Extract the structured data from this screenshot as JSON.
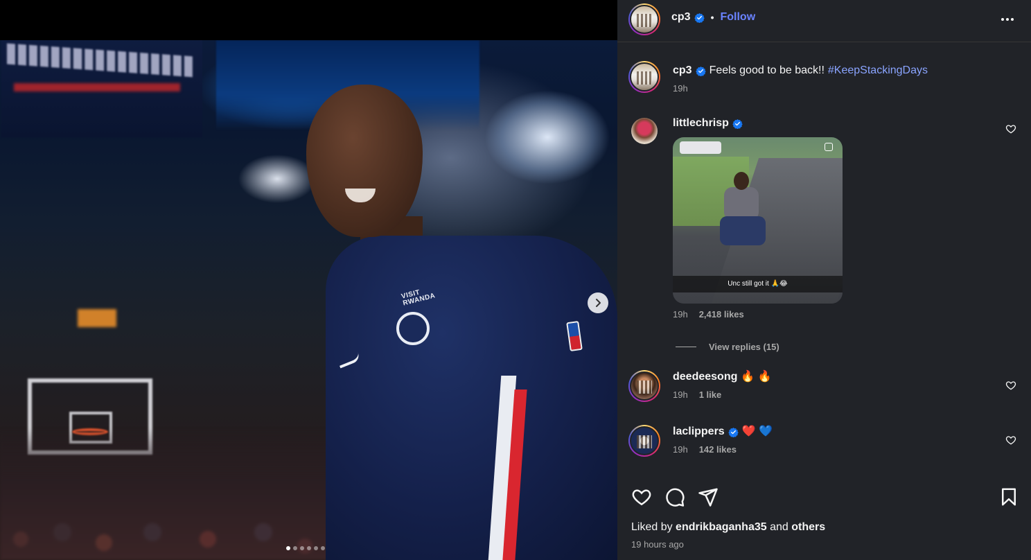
{
  "post": {
    "username": "cp3",
    "follow_label": "Follow",
    "separator": "•",
    "caption_text": "Feels good to be back!!",
    "caption_hashtag": "#KeepStackingDays",
    "caption_time": "19h",
    "liked_by_prefix": "Liked by",
    "liked_by_user": "endrikbaganha35",
    "liked_by_and": "and",
    "liked_by_others": "others",
    "time_ago": "19 hours ago"
  },
  "carousel": {
    "dots": 6,
    "active_index": 0
  },
  "comments": [
    {
      "username": "littlechrisp",
      "verified": true,
      "text": "",
      "time": "19h",
      "likes": "2,418 likes",
      "gif_caption": "Unc still got it 🙏😂",
      "view_replies": "View replies (15)"
    },
    {
      "username": "deedeesong",
      "verified": false,
      "text": "🔥 🔥",
      "time": "19h",
      "likes": "1 like"
    },
    {
      "username": "laclippers",
      "verified": true,
      "text": "❤️ 💙",
      "time": "19h",
      "likes": "142 likes"
    }
  ],
  "colors": {
    "panel_bg": "#212328",
    "follow": "#6a83ff",
    "hashtag": "#8aa4ff",
    "verified": "#1877f2",
    "muted": "#a8a8a8"
  },
  "icons": [
    "verified-badge-icon",
    "more-options-icon",
    "heart-icon",
    "comment-icon",
    "share-icon",
    "save-icon",
    "chevron-right-icon"
  ]
}
